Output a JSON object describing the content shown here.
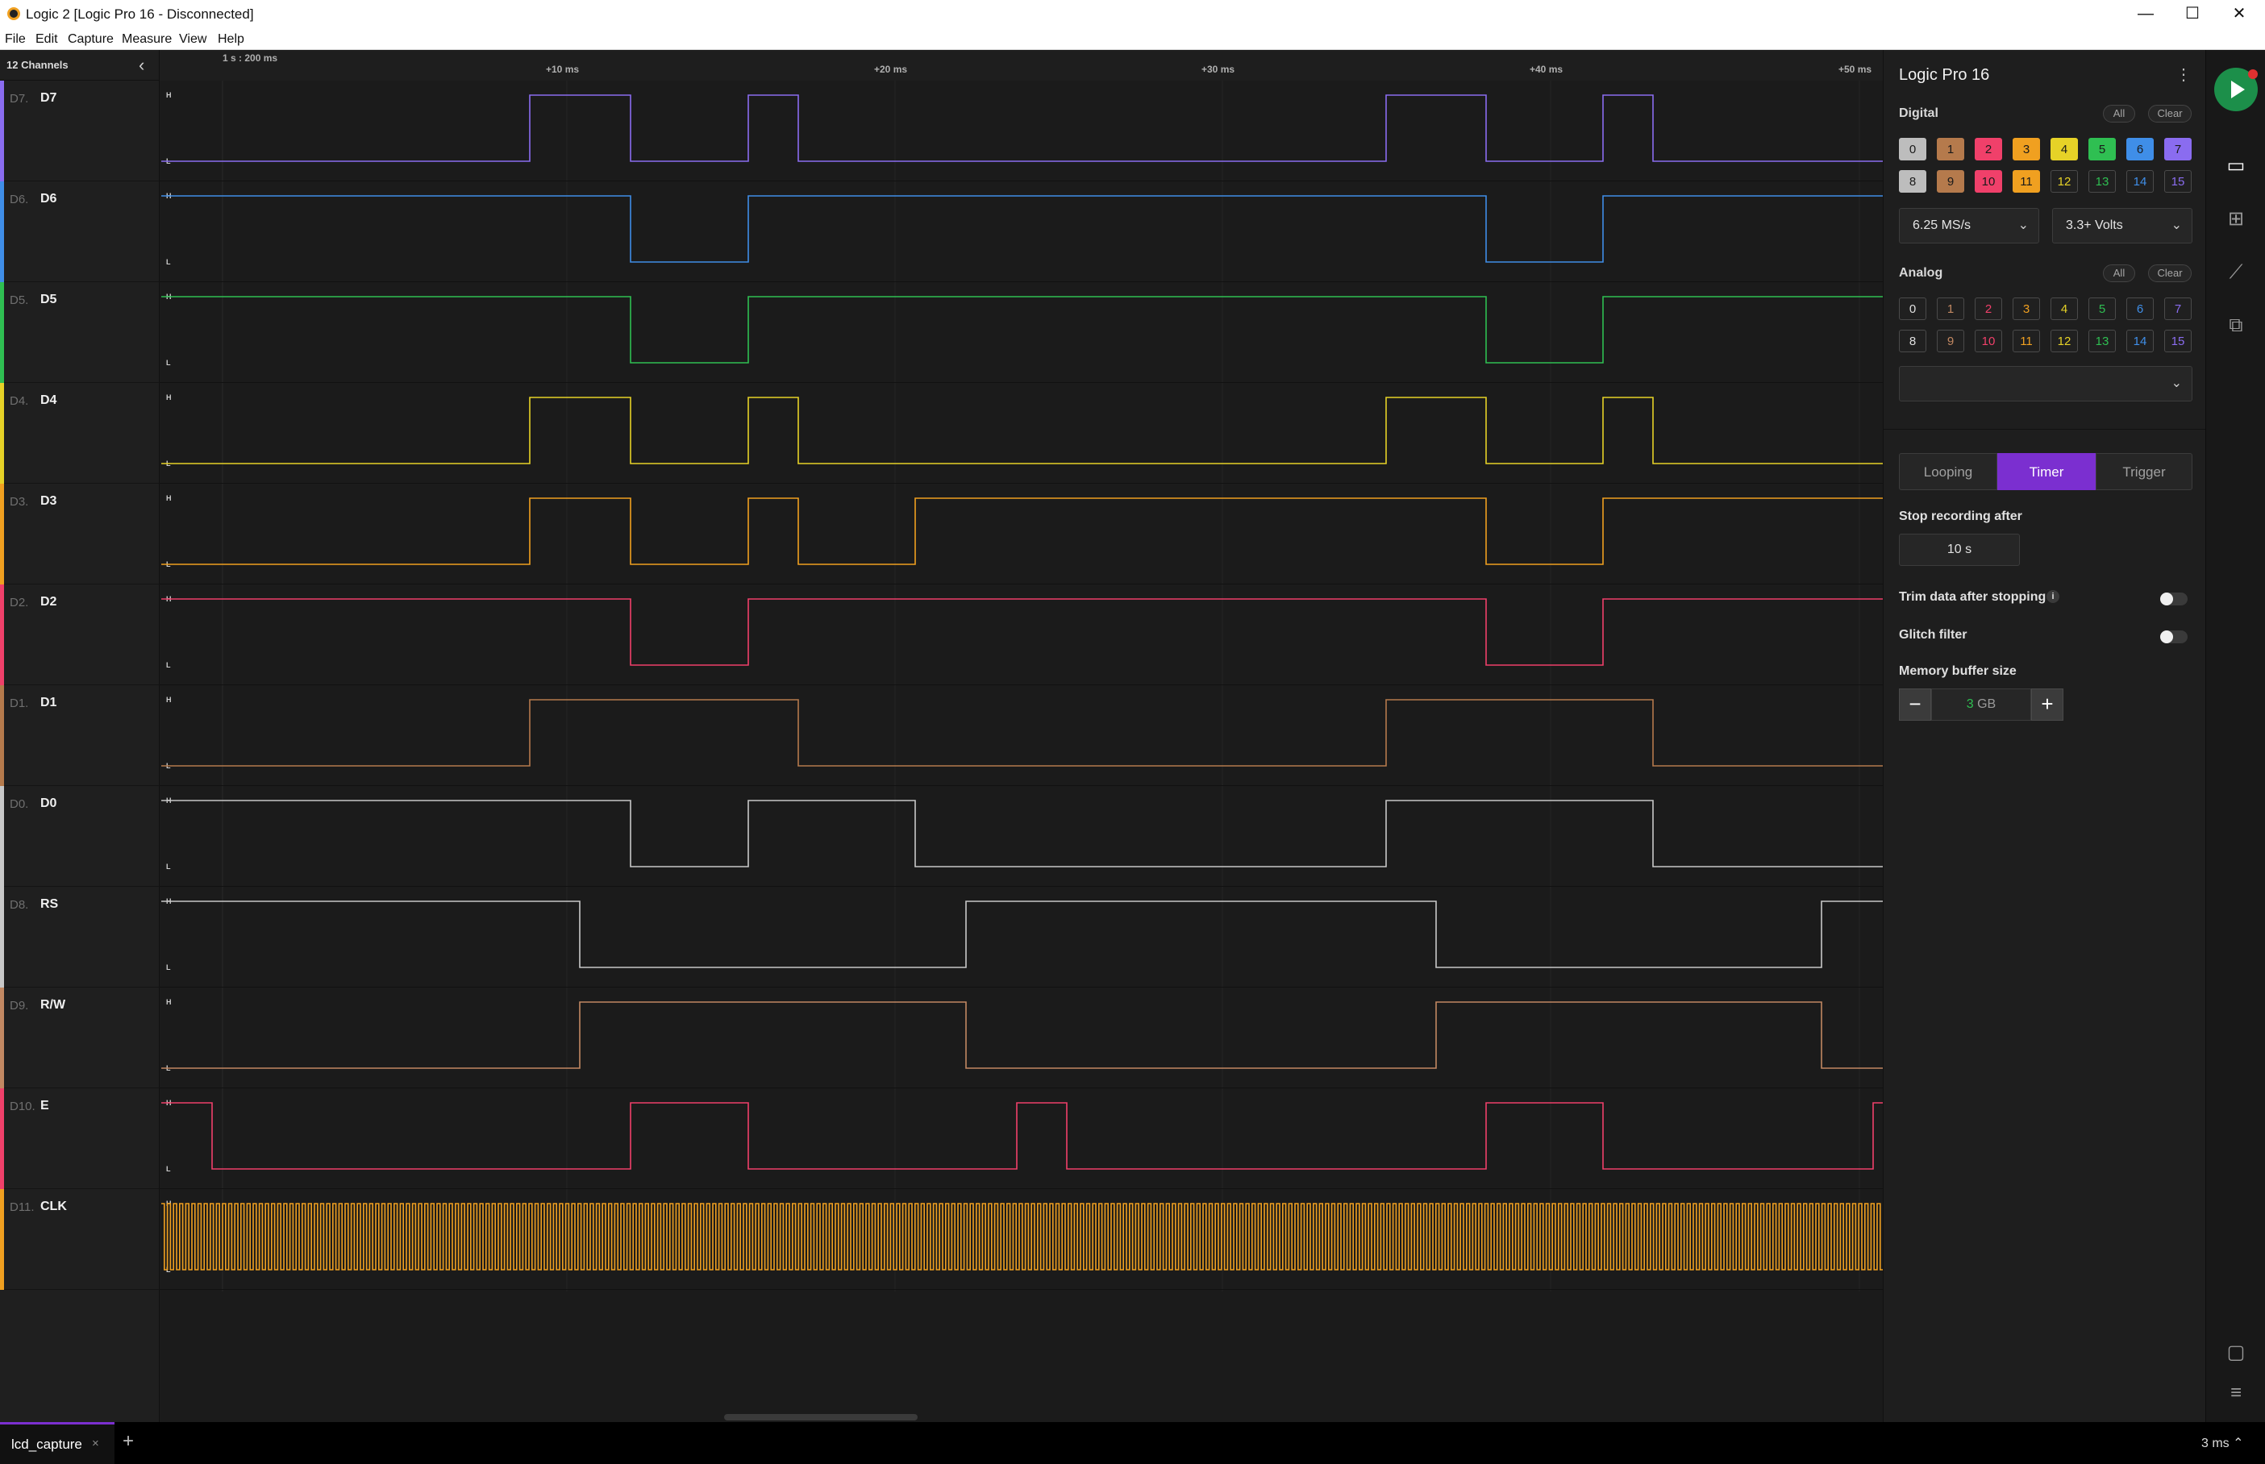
{
  "window": {
    "title": "Logic 2 [Logic Pro 16 - Disconnected]",
    "controls": {
      "minimize": "—",
      "maximize": "☐",
      "close": "✕"
    }
  },
  "menu": [
    "File",
    "Edit",
    "Capture",
    "Measure",
    "View",
    "Help"
  ],
  "sidebar": {
    "header": "12 Channels",
    "collapse_icon": "chevron-left-icon",
    "channels": [
      {
        "index": "D7.",
        "name": "D7",
        "color": "#8a6cf0"
      },
      {
        "index": "D6.",
        "name": "D6",
        "color": "#3f8ee8"
      },
      {
        "index": "D5.",
        "name": "D5",
        "color": "#2fbf52"
      },
      {
        "index": "D4.",
        "name": "D4",
        "color": "#e6d227"
      },
      {
        "index": "D3.",
        "name": "D3",
        "color": "#f0a020"
      },
      {
        "index": "D2.",
        "name": "D2",
        "color": "#f0406a"
      },
      {
        "index": "D1.",
        "name": "D1",
        "color": "#b57a4c"
      },
      {
        "index": "D0.",
        "name": "D0",
        "color": "#c8c8c8"
      },
      {
        "index": "D8.",
        "name": "RS",
        "color": "#c8c8c8"
      },
      {
        "index": "D9.",
        "name": "R/W",
        "color": "#c28862"
      },
      {
        "index": "D10.",
        "name": "E",
        "color": "#f0406a"
      },
      {
        "index": "D11.",
        "name": "CLK",
        "color": "#f0a020"
      }
    ]
  },
  "timeline": {
    "origin_label": "1 s : 200 ms",
    "ticks": [
      "+10 ms",
      "+20 ms",
      "+30 ms",
      "+40 ms",
      "+50 ms"
    ],
    "high_label": "H",
    "low_label": "L"
  },
  "panel": {
    "device": "Logic Pro 16",
    "digital": {
      "label": "Digital",
      "all": "All",
      "clear": "Clear",
      "channels": [
        {
          "n": "0",
          "color": "#bdbdbd",
          "on": true
        },
        {
          "n": "1",
          "color": "#b57a4c",
          "on": true
        },
        {
          "n": "2",
          "color": "#f0406a",
          "on": true
        },
        {
          "n": "3",
          "color": "#f0a020",
          "on": true
        },
        {
          "n": "4",
          "color": "#e6d227",
          "on": true
        },
        {
          "n": "5",
          "color": "#2fbf52",
          "on": true
        },
        {
          "n": "6",
          "color": "#3f8ee8",
          "on": true
        },
        {
          "n": "7",
          "color": "#8a6cf0",
          "on": true
        },
        {
          "n": "8",
          "color": "#bdbdbd",
          "on": true
        },
        {
          "n": "9",
          "color": "#b57a4c",
          "on": true
        },
        {
          "n": "10",
          "color": "#f0406a",
          "on": true
        },
        {
          "n": "11",
          "color": "#f0a020",
          "on": true
        },
        {
          "n": "12",
          "color": "#e6d227",
          "on": false
        },
        {
          "n": "13",
          "color": "#2fbf52",
          "on": false
        },
        {
          "n": "14",
          "color": "#3f8ee8",
          "on": false
        },
        {
          "n": "15",
          "color": "#8a6cf0",
          "on": false
        }
      ]
    },
    "sample_rate": "6.25 MS/s",
    "voltage": "3.3+ Volts",
    "analog": {
      "label": "Analog",
      "all": "All",
      "clear": "Clear",
      "channels": [
        {
          "n": "0",
          "color": "#e0e0e0"
        },
        {
          "n": "1",
          "color": "#c28862"
        },
        {
          "n": "2",
          "color": "#f0406a"
        },
        {
          "n": "3",
          "color": "#f0a020"
        },
        {
          "n": "4",
          "color": "#e6d227"
        },
        {
          "n": "5",
          "color": "#2fbf52"
        },
        {
          "n": "6",
          "color": "#3f8ee8"
        },
        {
          "n": "7",
          "color": "#8a6cf0"
        },
        {
          "n": "8",
          "color": "#e0e0e0"
        },
        {
          "n": "9",
          "color": "#c28862"
        },
        {
          "n": "10",
          "color": "#f0406a"
        },
        {
          "n": "11",
          "color": "#f0a020"
        },
        {
          "n": "12",
          "color": "#e6d227"
        },
        {
          "n": "13",
          "color": "#2fbf52"
        },
        {
          "n": "14",
          "color": "#3f8ee8"
        },
        {
          "n": "15",
          "color": "#8a6cf0"
        }
      ],
      "rate_value": ""
    },
    "modes": [
      "Looping",
      "Timer",
      "Trigger"
    ],
    "active_mode": "Timer",
    "stop_recording_label": "Stop recording after",
    "stop_recording_value": "10 s",
    "trim_label": "Trim data after stopping",
    "trim_info": "i",
    "trim_on": false,
    "glitch_label": "Glitch filter",
    "glitch_on": false,
    "memory_label": "Memory buffer size",
    "memory_number": "3",
    "memory_unit": "GB",
    "minus": "−",
    "plus": "+"
  },
  "rail": {
    "icons": [
      "device-settings-icon",
      "analyzers-icon",
      "measurements-icon",
      "extensions-icon"
    ],
    "bottom_icons": [
      "feedback-icon",
      "menu-icon"
    ]
  },
  "tabs": [
    {
      "label": "lcd_capture",
      "close": "×"
    }
  ],
  "add_tab": "+",
  "zoom": "3 ms"
}
